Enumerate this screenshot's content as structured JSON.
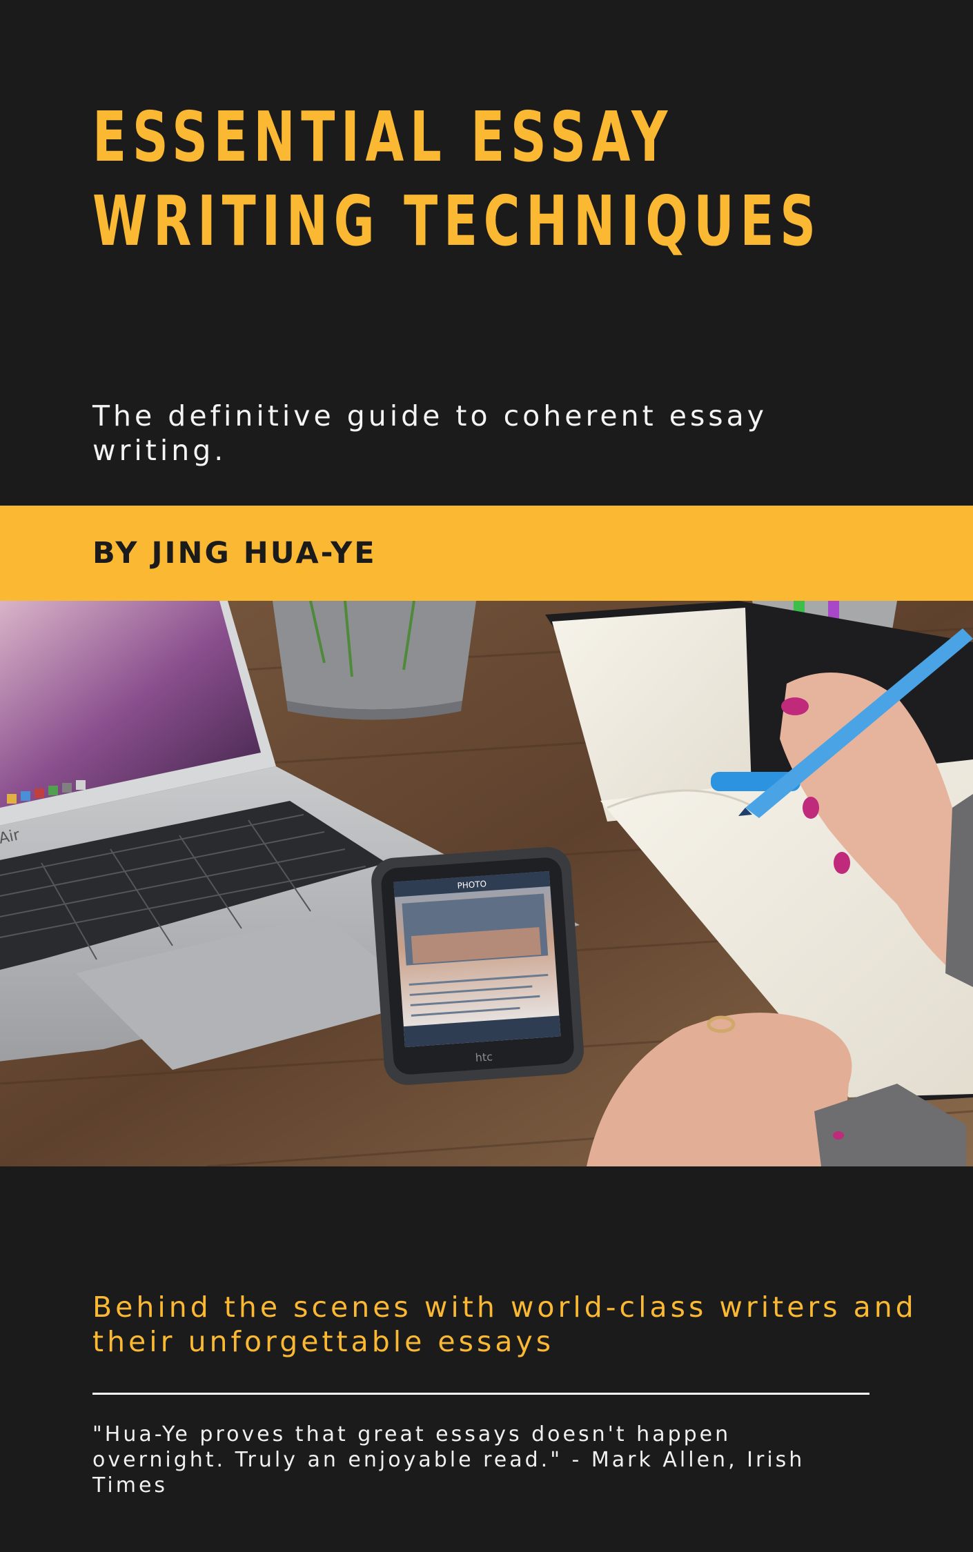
{
  "cover": {
    "title_line1": "ESSENTIAL ESSAY",
    "title_line2": "WRITING TECHNIQUES",
    "subtitle": "The definitive guide to coherent essay writing.",
    "author": "BY JING HUA-YE",
    "tagline": "Behind the scenes with world-class writers and their unforgettable essays",
    "quote": "\"Hua-Ye proves that great essays doesn't happen overnight. Truly an enjoyable read.\" - Mark Allen, Irish Times"
  },
  "photo": {
    "laptop_label": "Air",
    "phone_header": "PHOTO",
    "phone_brand": "htc"
  },
  "colors": {
    "background": "#1b1b1c",
    "accent": "#fbb933",
    "text_light": "#f4f4f4"
  }
}
